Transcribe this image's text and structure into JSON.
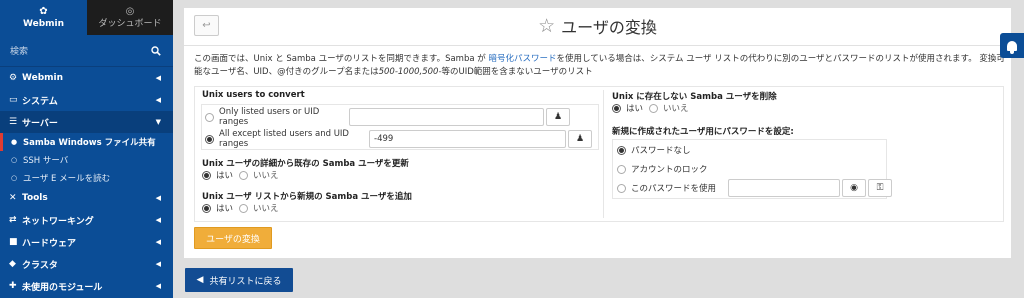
{
  "sidebar": {
    "webmin_tab": "Webmin",
    "dashboard_tab": "ダッシュボード",
    "search_placeholder": "検索",
    "items": [
      {
        "label": "Webmin",
        "icon": "gear-icon"
      },
      {
        "label": "システム",
        "icon": "laptop-icon"
      },
      {
        "label": "サーバー",
        "icon": "server-icon"
      },
      {
        "label": "Tools",
        "icon": "wrench-icon"
      },
      {
        "label": "ネットワーキング",
        "icon": "network-icon"
      },
      {
        "label": "ハードウェア",
        "icon": "hardware-icon"
      },
      {
        "label": "クラスタ",
        "icon": "stack-icon"
      },
      {
        "label": "未使用のモジュール",
        "icon": "puzzle-icon"
      }
    ],
    "sub_items": [
      {
        "label": "Samba Windows ファイル共有"
      },
      {
        "label": "SSH サーバ"
      },
      {
        "label": "ユーザ E メールを読む"
      }
    ]
  },
  "page": {
    "title": "ユーザの変換",
    "desc_1": "この画面では、Unix と Samba ユーザのリストを同期できます。Samba が ",
    "desc_link": "暗号化パスワード",
    "desc_2": "を使用している場合は、システム ユーザ リストの代わりに別のユーザとパスワードのリストが使用されます。 変換可能なユーザ名、UID、@付きのグループ名または",
    "desc_italic": "500-1000,500-",
    "desc_3": "等のUID範囲を含まないユーザのリスト"
  },
  "form": {
    "unix_users_label": "Unix users to convert",
    "only_listed_label": "Only listed users or UID ranges",
    "only_listed_value": "",
    "all_except_label": "All except listed users and UID ranges",
    "all_except_value": "-499",
    "update_label": "Unix ユーザの詳細から既存の Samba ユーザを更新",
    "add_label": "Unix ユーザ リストから新規の Samba ユーザを追加",
    "delete_label": "Unix に存在しない Samba ユーザを削除",
    "yes": "はい",
    "no": "いいえ",
    "password_label": "新規に作成されたユーザ用にパスワードを設定:",
    "pw_none": "パスワードなし",
    "pw_lock": "アカウントのロック",
    "pw_use": "このパスワードを使用",
    "pw_value": ""
  },
  "buttons": {
    "convert": "ユーザの変換",
    "return": "共有リストに戻る"
  },
  "colors": {
    "sidebar": "#0b4d96",
    "convert_button": "#f0ad3a",
    "return_button": "#124c93",
    "link": "#2a6fc1"
  }
}
